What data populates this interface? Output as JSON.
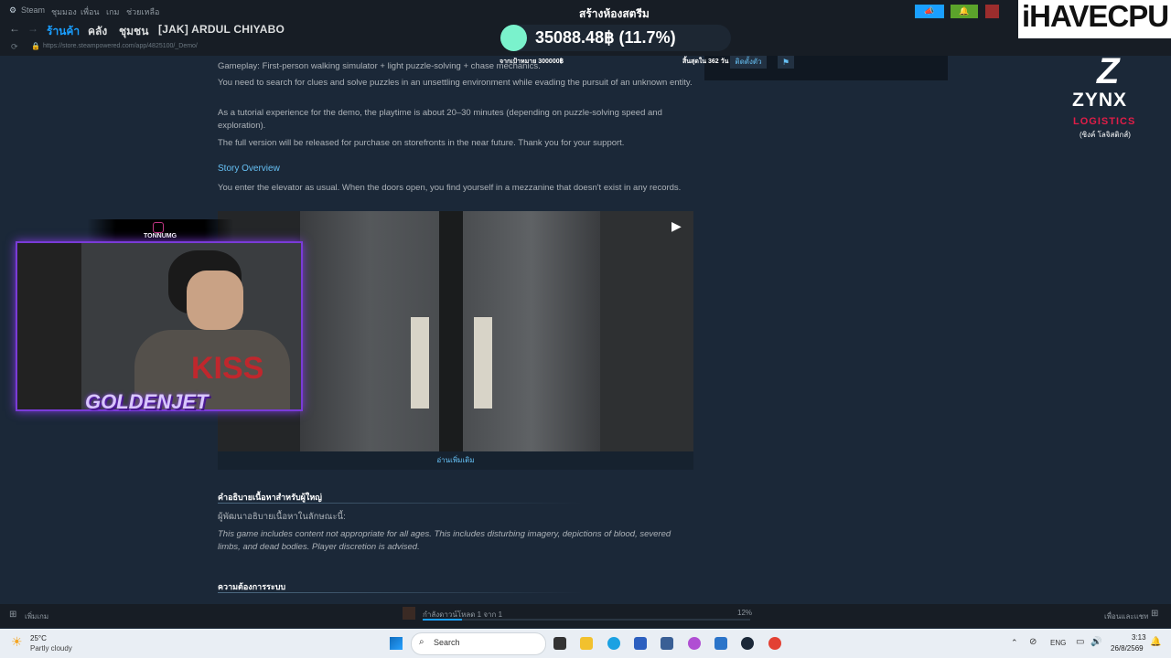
{
  "steam_menu": {
    "app": "Steam",
    "items": [
      "ชุมมอง",
      "เพื่อน",
      "เกม",
      "ช่วยเหลือ"
    ]
  },
  "nav": {
    "links": [
      "ร้านค้า",
      "คลัง",
      "ชุมชน"
    ],
    "title": "[JAK] ARDUL CHIYABO",
    "url": "https://store.steampowered.com/app/4825100/_Demo/"
  },
  "overlay": {
    "stream_title": "สร้างห้องสตรีม",
    "amount": "35088.48฿ (11.7%)",
    "goal": "จากเป้าหมาย 300000฿",
    "ends": "สิ้นสุดใน 362 วัน",
    "logo": "iHAVECPU",
    "sponsor_name": "ZYNX",
    "sponsor_sub": "LOGISTICS",
    "sponsor_thai": "(ซิงค์ โลจิสติกส์)",
    "instagram_handle": "TONNUMG",
    "webcam_banner": "GOLDENJET"
  },
  "right_panel": {
    "follow": "ติดตั้งตัว",
    "flag_icon": "flag-icon"
  },
  "content": {
    "para_gameplay": "Gameplay: First-person walking simulator + light puzzle-solving + chase mechanics.",
    "para_search": "You need to search for clues and solve puzzles in an unsettling environment while evading the pursuit of an unknown entity.",
    "para_tutorial": "As a tutorial experience for the demo, the playtime is about 20–30 minutes (depending on puzzle-solving speed and exploration).",
    "para_full": "The full version will be released for purchase on storefronts in the near future. Thank you for your support.",
    "story_heading": "Story Overview",
    "story_text": "You enter the elevator as usual. When the doors open, you find yourself in a mezzanine that doesn't exist in any records.",
    "read_more": "อ่านเพิ่มเติม",
    "mature_heading": "คำอธิบายเนื้อหาสำหรับผู้ใหญ่",
    "mature_sub": "ผู้พัฒนาอธิบายเนื้อหาในลักษณะนี้:",
    "mature_text": "This game includes content not appropriate for all ages. This includes disturbing imagery, depictions of blood, severed limbs, and dead bodies. Player discretion is advised.",
    "sysreq_heading": "ความต้องการระบบ"
  },
  "bottom_bar": {
    "add_game": "เพิ่มเกม",
    "download": "กำลังดาวน์โหลด 1 จาก 1",
    "progress_label": "12%",
    "progress": 0.12,
    "friends_chat": "เพื่อนและแชท"
  },
  "taskbar": {
    "temp": "25°C",
    "weather": "Partly cloudy",
    "search": "Search",
    "lang": "ENG",
    "time": "3:13",
    "date": "26/8/2569"
  },
  "colors": {
    "steam_bg": "#1b2838",
    "accent": "#1a9fff",
    "link": "#66c0f4",
    "donation_dot": "#7af2cc",
    "webcam_border": "#7a3bd8"
  }
}
